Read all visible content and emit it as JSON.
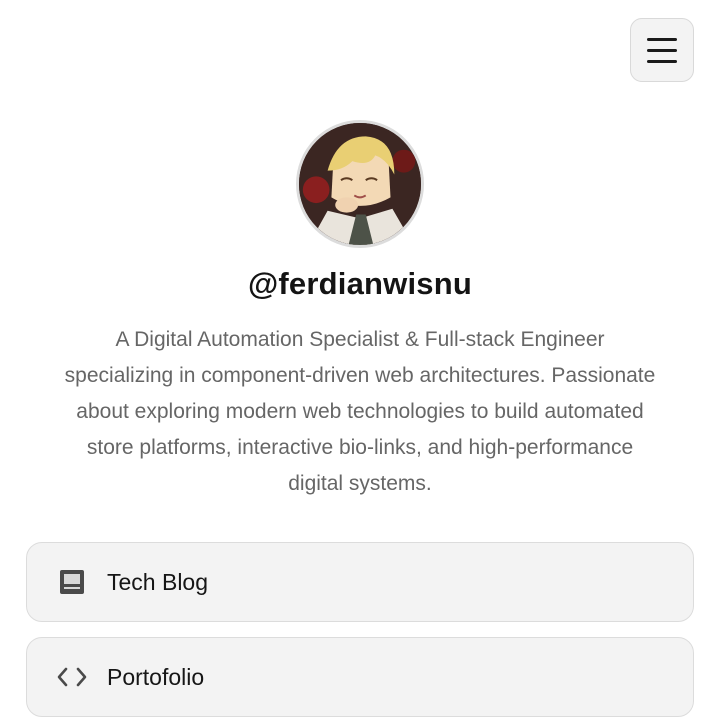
{
  "header": {
    "menu_icon": "hamburger-menu-icon"
  },
  "profile": {
    "avatar_icon": "anime-character-avatar",
    "handle": "@ferdianwisnu",
    "bio": "A Digital Automation Specialist & Full-stack Engineer specializing in component-driven web architectures. Passionate about exploring modern web technologies to build automated store platforms, interactive bio-links, and high-performance digital systems."
  },
  "links": [
    {
      "label": "Tech Blog",
      "icon": "book-icon"
    },
    {
      "label": "Portofolio",
      "icon": "code-icon"
    }
  ],
  "colors": {
    "background": "#ffffff",
    "card_background": "#f3f3f3",
    "card_border": "#dcdcdc",
    "text_primary": "#141414",
    "text_secondary": "#666666"
  }
}
